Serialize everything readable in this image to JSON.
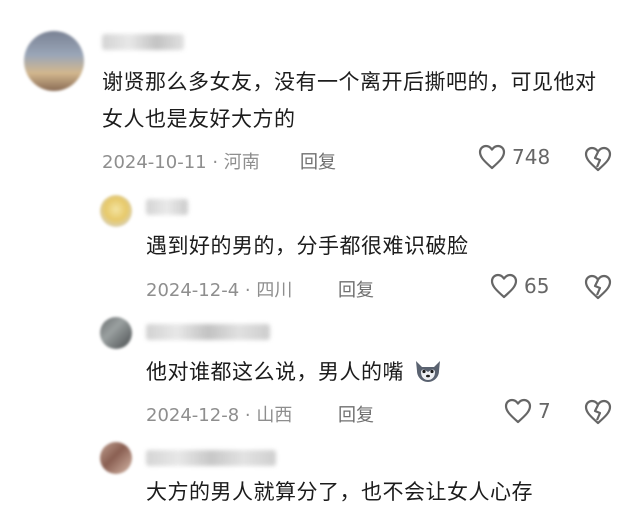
{
  "comments": [
    {
      "text": "谢贤那么多女友，没有一个离开后撕吧的，可见他对女人也是友好大方的",
      "meta": "2024-10-11 · 河南",
      "reply_label": "回复",
      "likes": "748",
      "avatar_icon": "user-avatar"
    },
    {
      "text": "遇到好的男的，分手都很难识破脸",
      "meta": "2024-12-4 · 四川",
      "reply_label": "回复",
      "likes": "65",
      "avatar_icon": "user-avatar"
    },
    {
      "text": "他对谁都这么说，男人的嘴",
      "meta": "2024-12-8 · 山西",
      "reply_label": "回复",
      "likes": "7",
      "avatar_icon": "user-avatar",
      "emoji": "wolf-emoji"
    },
    {
      "text": "大方的男人就算分了，也不会让女人心存",
      "avatar_icon": "user-avatar"
    }
  ],
  "colors": {
    "text": "#1c1c1c",
    "meta": "#8e8e8e",
    "icon": "#666666"
  }
}
